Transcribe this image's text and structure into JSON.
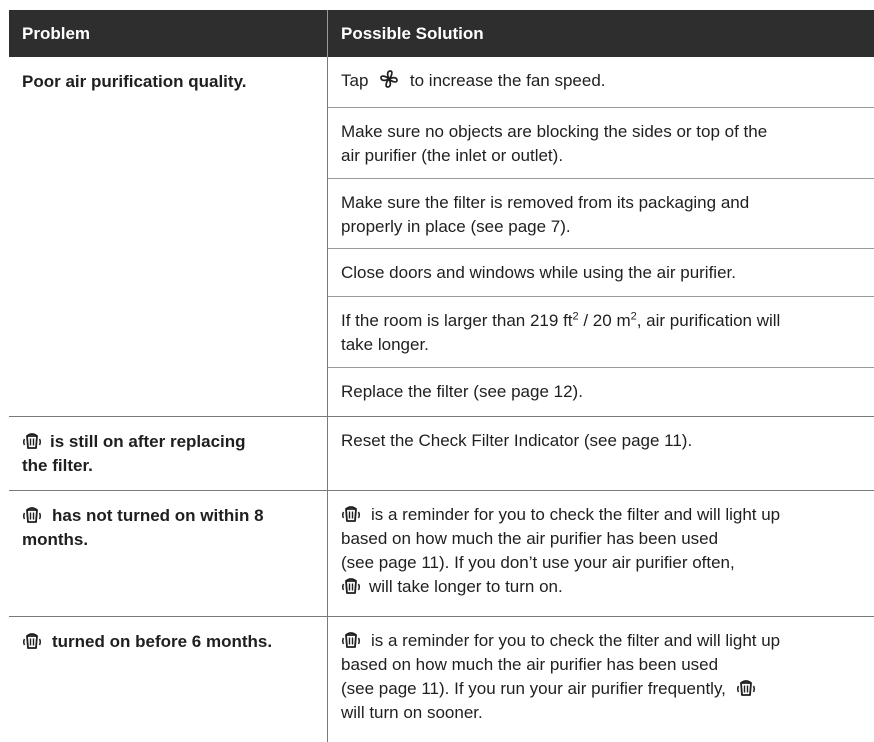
{
  "header": {
    "problem_label": "Problem",
    "solution_label": "Possible Solution"
  },
  "row1": {
    "problem": "Poor air purification quality.",
    "s1_before": "Tap",
    "s1_after": "to increase the fan speed.",
    "s2_l1": "Make sure no objects are blocking the sides or top of the",
    "s2_l2": "air purifier (the inlet or outlet).",
    "s3_l1": "Make sure the filter is removed from its packaging and",
    "s3_l2": "properly in place (see page 7).",
    "s4": "Close doors and windows while using the air purifier.",
    "s5_a": "If the room is larger than 219 ft",
    "s5_sup1": "2",
    "s5_b": " / 20 m",
    "s5_sup2": "2",
    "s5_c": ", air purification will",
    "s5_l2": "take longer.",
    "s6": "Replace the filter (see page 12)."
  },
  "row2": {
    "problem_l1": "is still on after replacing",
    "problem_l2": "the filter.",
    "solution": "Reset the Check Filter Indicator (see page 11)."
  },
  "row3": {
    "problem_l1": "has not turned on within 8",
    "problem_l2": "months.",
    "sol_l1": "is a reminder for you to check the filter and will light up",
    "sol_l2": "based on how much the air purifier has been used",
    "sol_l3": "(see page 11). If you don’t use your air purifier often,",
    "sol_l4": "will take longer to turn on."
  },
  "row4": {
    "problem": "turned on before 6 months.",
    "sol_l1": "is a reminder for you to check the filter and will light up",
    "sol_l2": "based on how much the air purifier has been used",
    "sol_l3": "(see page 11). If you run your air purifier frequently,",
    "sol_l4": "will turn on sooner."
  },
  "icons": {
    "fan": "fan-icon",
    "filter": "check-filter-icon"
  }
}
